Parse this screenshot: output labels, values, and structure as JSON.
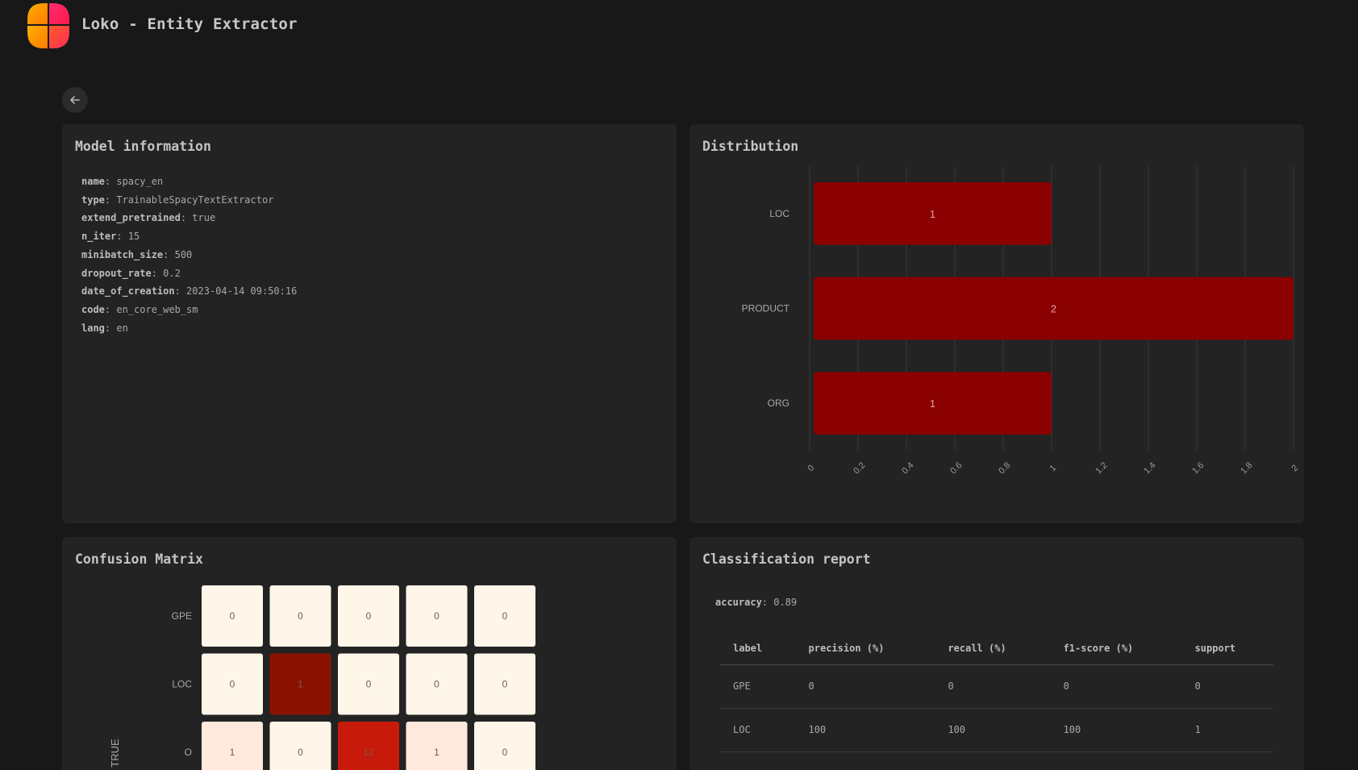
{
  "app": {
    "title": "Loko - Entity Extractor"
  },
  "nav": {
    "back_icon": "arrow-left-icon"
  },
  "model_info": {
    "title": "Model information",
    "fields": [
      {
        "key": "name",
        "value": "spacy_en"
      },
      {
        "key": "type",
        "value": "TrainableSpacyTextExtractor"
      },
      {
        "key": "extend_pretrained",
        "value": "true"
      },
      {
        "key": "n_iter",
        "value": "15"
      },
      {
        "key": "minibatch_size",
        "value": "500"
      },
      {
        "key": "dropout_rate",
        "value": "0.2"
      },
      {
        "key": "date_of_creation",
        "value": "2023-04-14 09:50:16"
      },
      {
        "key": "code",
        "value": "en_core_web_sm"
      },
      {
        "key": "lang",
        "value": "en"
      }
    ]
  },
  "distribution": {
    "title": "Distribution",
    "chart_data": {
      "type": "bar",
      "orientation": "horizontal",
      "categories": [
        "LOC",
        "PRODUCT",
        "ORG"
      ],
      "values": [
        1,
        2,
        1
      ],
      "xlim": [
        0,
        2
      ],
      "x_ticks": [
        "0",
        "0.2",
        "0.4",
        "0.6",
        "0.8",
        "1",
        "1.2",
        "1.4",
        "1.6",
        "1.8",
        "2"
      ],
      "grid": true,
      "bar_color": "#8b0000"
    }
  },
  "confusion_matrix": {
    "title": "Confusion Matrix",
    "y_axis_label": "TRUE",
    "rows": [
      {
        "label": "GPE",
        "values": [
          0,
          0,
          0,
          0,
          0
        ]
      },
      {
        "label": "LOC",
        "values": [
          0,
          1,
          0,
          0,
          0
        ]
      },
      {
        "label": "O",
        "values": [
          1,
          0,
          12,
          1,
          0
        ]
      }
    ]
  },
  "report": {
    "title": "Classification report",
    "accuracy_key": "accuracy",
    "accuracy_value": "0.89",
    "columns": [
      "label",
      "precision (%)",
      "recall (%)",
      "f1-score (%)",
      "support"
    ],
    "rows": [
      [
        "GPE",
        "0",
        "0",
        "0",
        "0"
      ],
      [
        "LOC",
        "100",
        "100",
        "100",
        "1"
      ]
    ]
  }
}
